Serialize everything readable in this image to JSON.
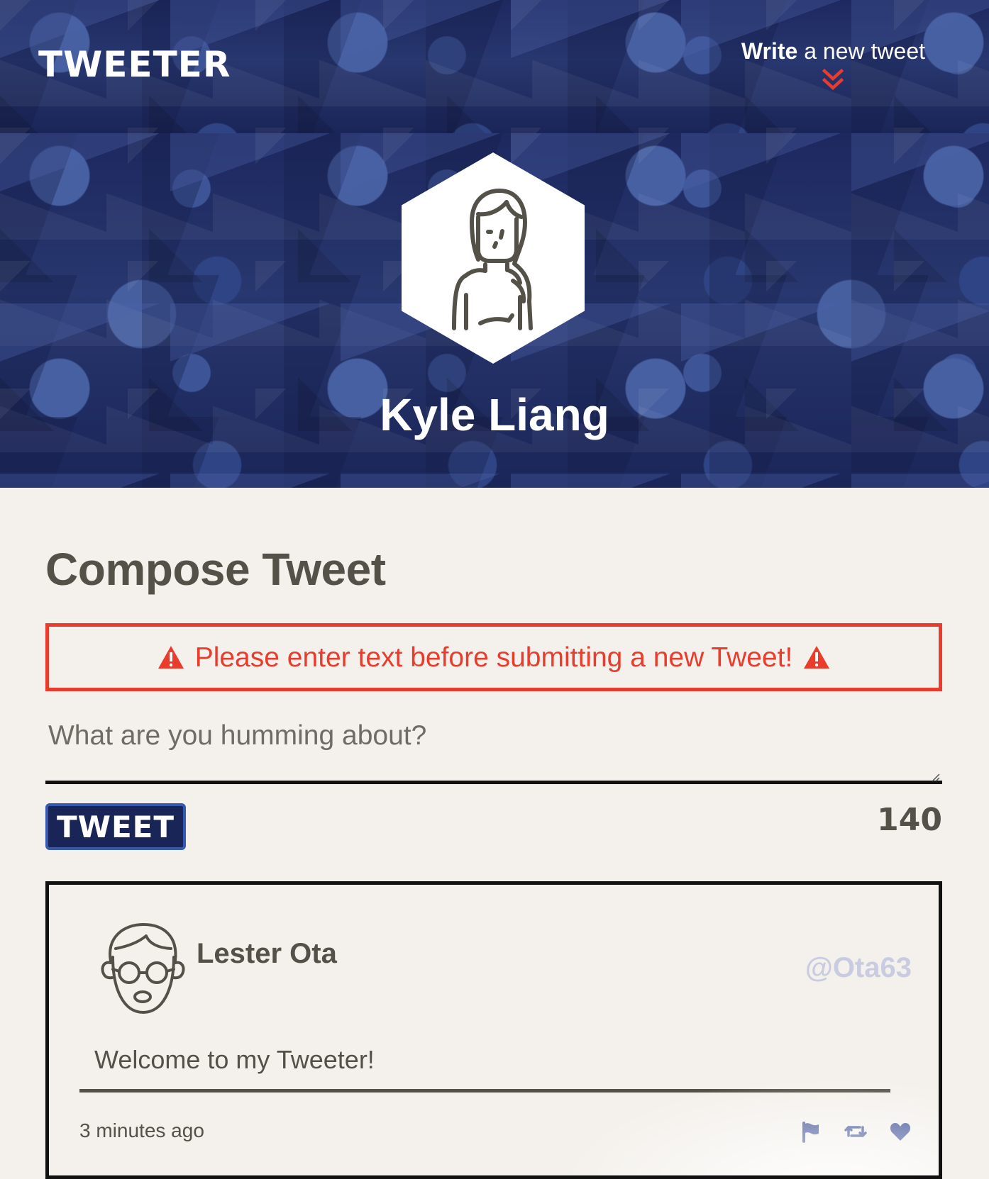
{
  "header": {
    "brand": "TWEETER",
    "write_bold": "Write",
    "write_rest": " a new tweet",
    "write_icon": "double-chevron-down-icon",
    "colors": {
      "navy": "#1a2558",
      "accent": "#ea3c2d",
      "white": "#ffffff"
    }
  },
  "profile": {
    "name": "Kyle Liang",
    "avatar_icon": "woman-avatar-icon"
  },
  "compose": {
    "title": "Compose Tweet",
    "error_message": "Please enter text before submitting a new Tweet!",
    "error_icon": "warning-triangle-icon",
    "placeholder": "What are you humming about?",
    "submit_label": "TWEET",
    "counter": "140"
  },
  "tweet": {
    "author_name": "Lester Ota",
    "author_handle": "@Ota63",
    "text": "Welcome to my Tweeter!",
    "timestamp": "3 minutes ago",
    "avatar_icon": "man-glasses-avatar-icon",
    "actions": [
      {
        "name": "flag-icon",
        "color": "#3d4f95"
      },
      {
        "name": "retweet-icon",
        "color": "#3d4f95"
      },
      {
        "name": "heart-icon",
        "color": "#3d4f95"
      }
    ]
  }
}
